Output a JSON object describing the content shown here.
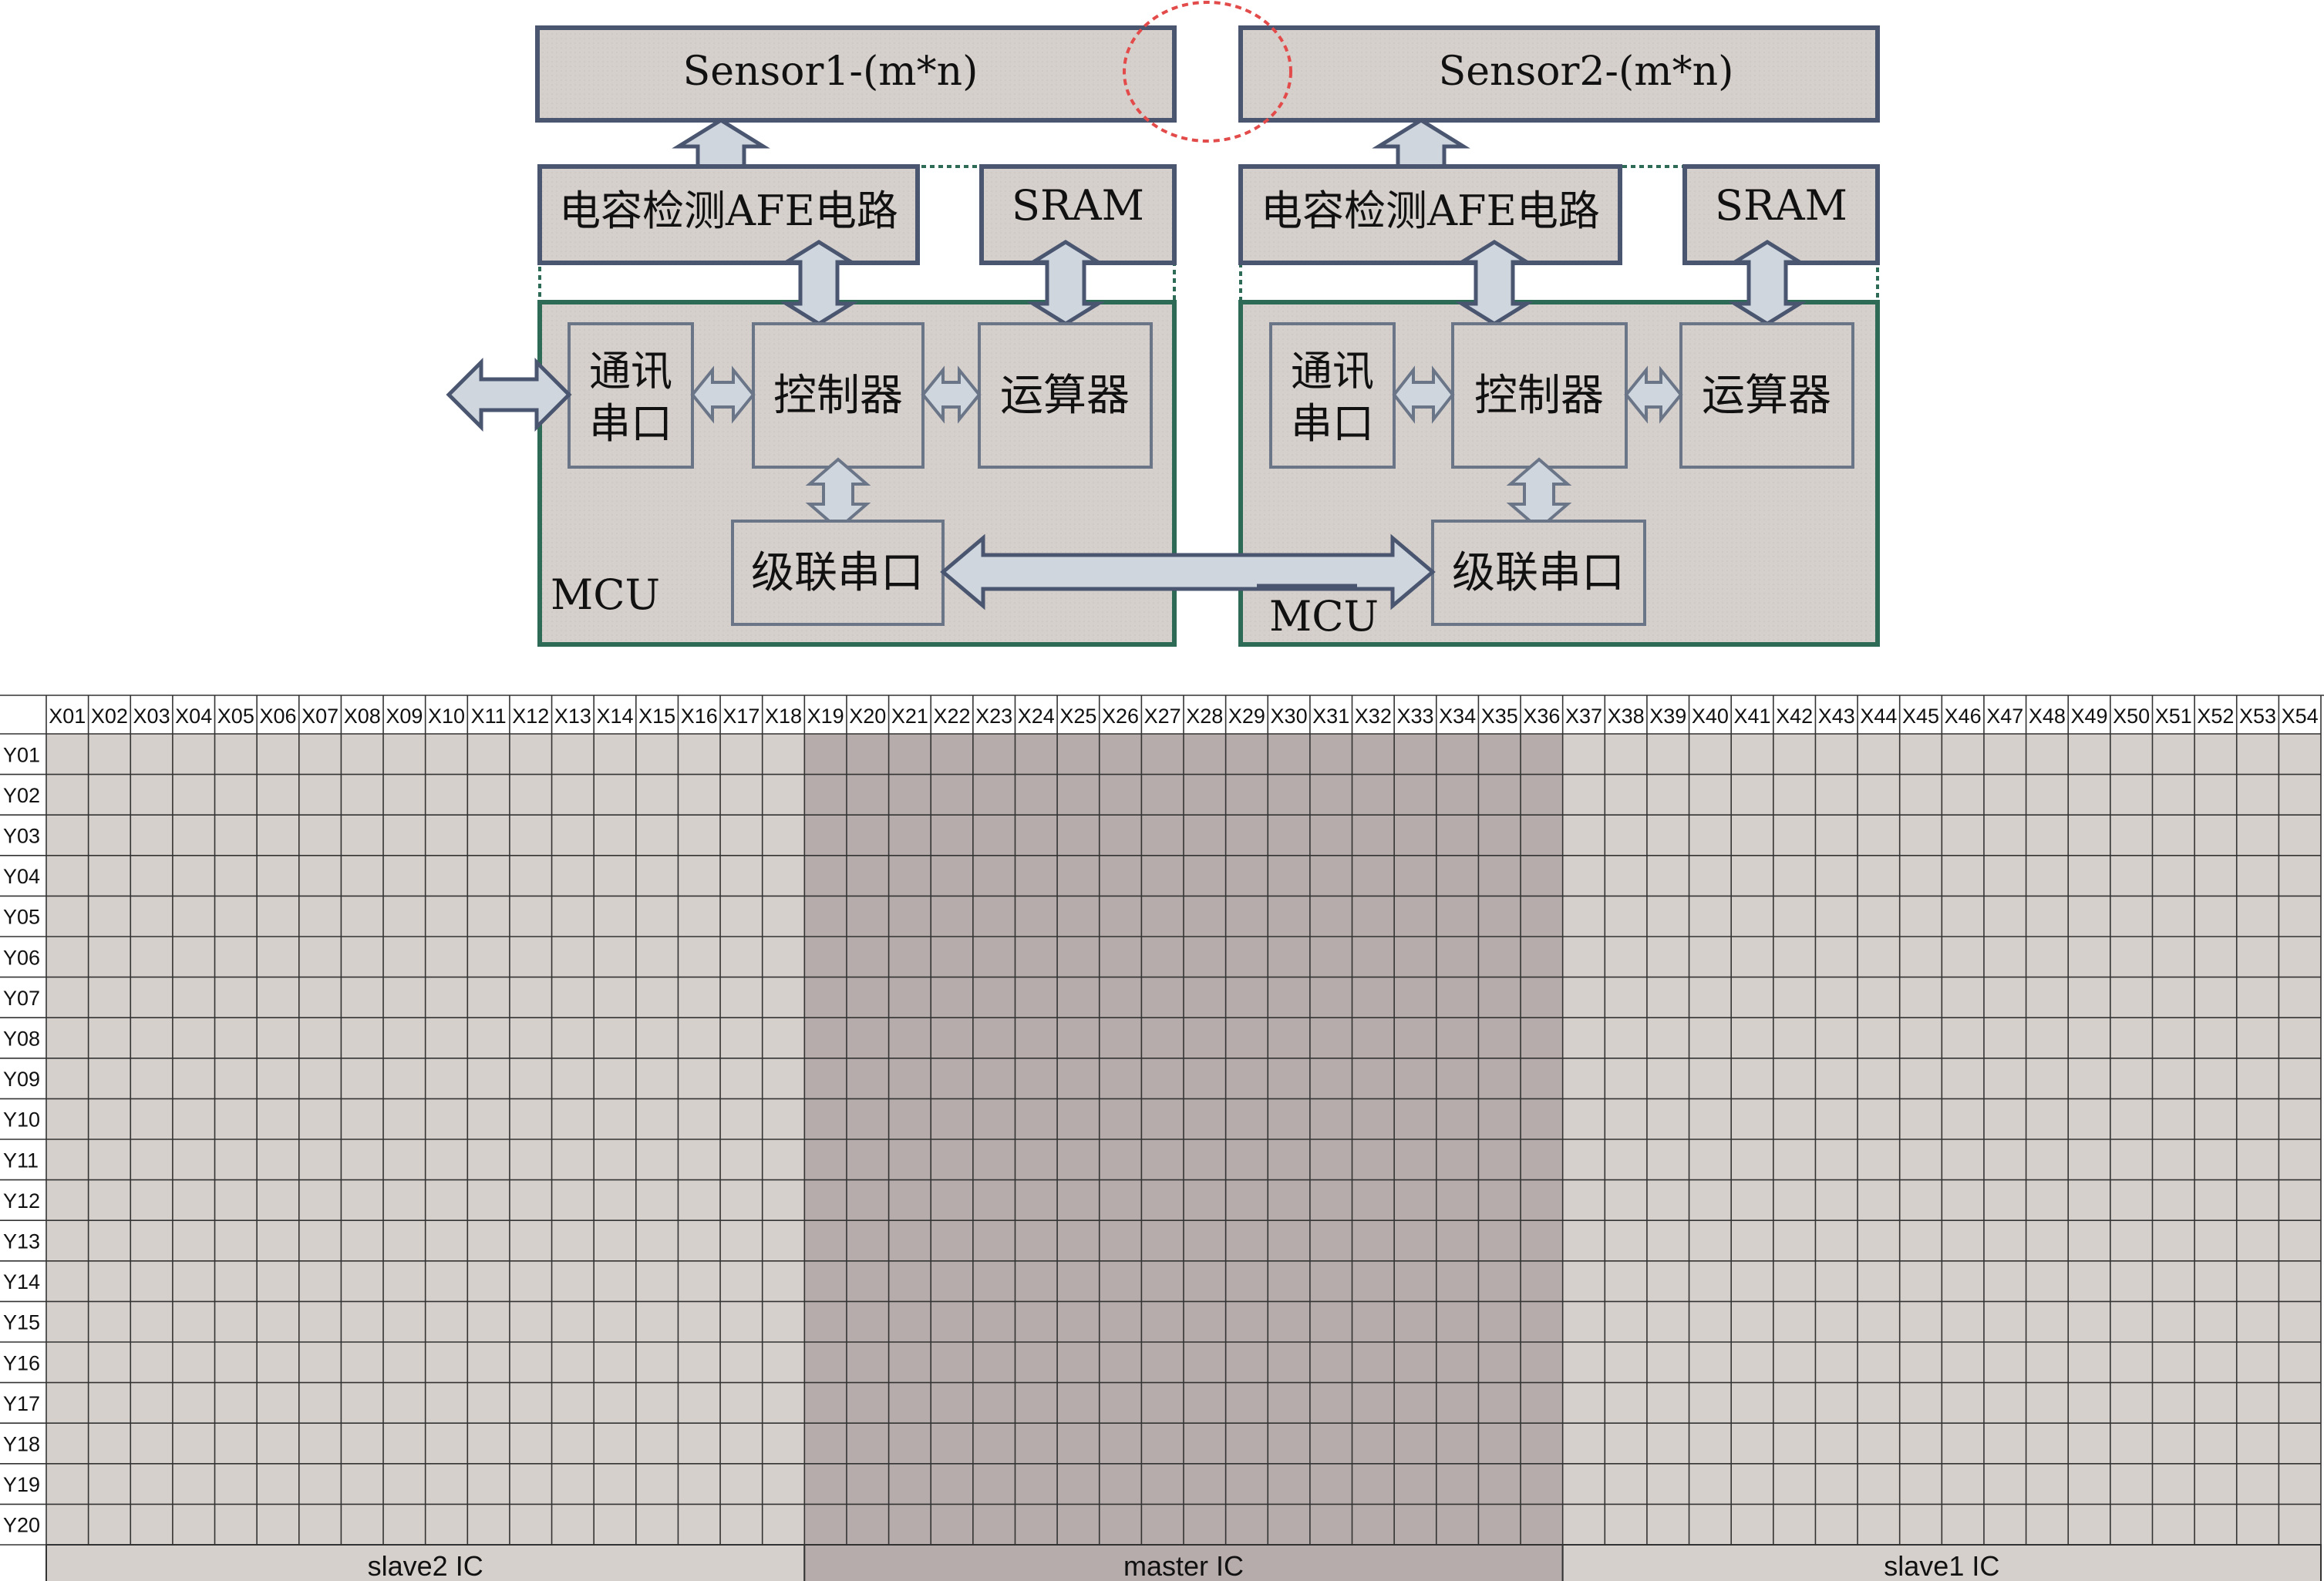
{
  "block_diagram": {
    "sensor1_label": "Sensor1-(m*n)",
    "sensor2_label": "Sensor2-(m*n)",
    "afe_label": "电容检测AFE电路",
    "sram_label": "SRAM",
    "comm_port_line1": "通讯",
    "comm_port_line2": "串口",
    "controller_label": "控制器",
    "alu_label": "运算器",
    "cascade_port_label": "级联串口",
    "mcu_label": "MCU"
  },
  "sensor_grid": {
    "x_labels": [
      "X01",
      "X02",
      "X03",
      "X04",
      "X05",
      "X06",
      "X07",
      "X08",
      "X09",
      "X10",
      "X11",
      "X12",
      "X13",
      "X14",
      "X15",
      "X16",
      "X17",
      "X18",
      "X19",
      "X20",
      "X21",
      "X22",
      "X23",
      "X24",
      "X25",
      "X26",
      "X27",
      "X28",
      "X29",
      "X30",
      "X31",
      "X32",
      "X33",
      "X34",
      "X35",
      "X36",
      "X37",
      "X38",
      "X39",
      "X40",
      "X41",
      "X42",
      "X43",
      "X44",
      "X45",
      "X46",
      "X47",
      "X48",
      "X49",
      "X50",
      "X51",
      "X52",
      "X53",
      "X54"
    ],
    "y_labels": [
      "Y01",
      "Y02",
      "Y03",
      "Y04",
      "Y05",
      "Y06",
      "Y07",
      "Y08",
      "Y09",
      "Y10",
      "Y11",
      "Y12",
      "Y13",
      "Y14",
      "Y15",
      "Y16",
      "Y17",
      "Y18",
      "Y19",
      "Y20"
    ],
    "regions": [
      {
        "label": "slave2 IC",
        "columns": 18,
        "color": "#d6d0cc"
      },
      {
        "label": "master IC",
        "columns": 18,
        "color": "#b5acab"
      },
      {
        "label": "slave1 IC",
        "columns": 18,
        "color": "#d6d0cc"
      }
    ]
  },
  "colors": {
    "block_fill": "#d6d0cc",
    "block_border": "#4a5670",
    "mcu_border": "#2e6b57",
    "arrow_fill": "#cfd6de",
    "arrow_stroke": "#4a5670",
    "highlight_circle": "#e34a4a",
    "grid_line": "#333333"
  }
}
